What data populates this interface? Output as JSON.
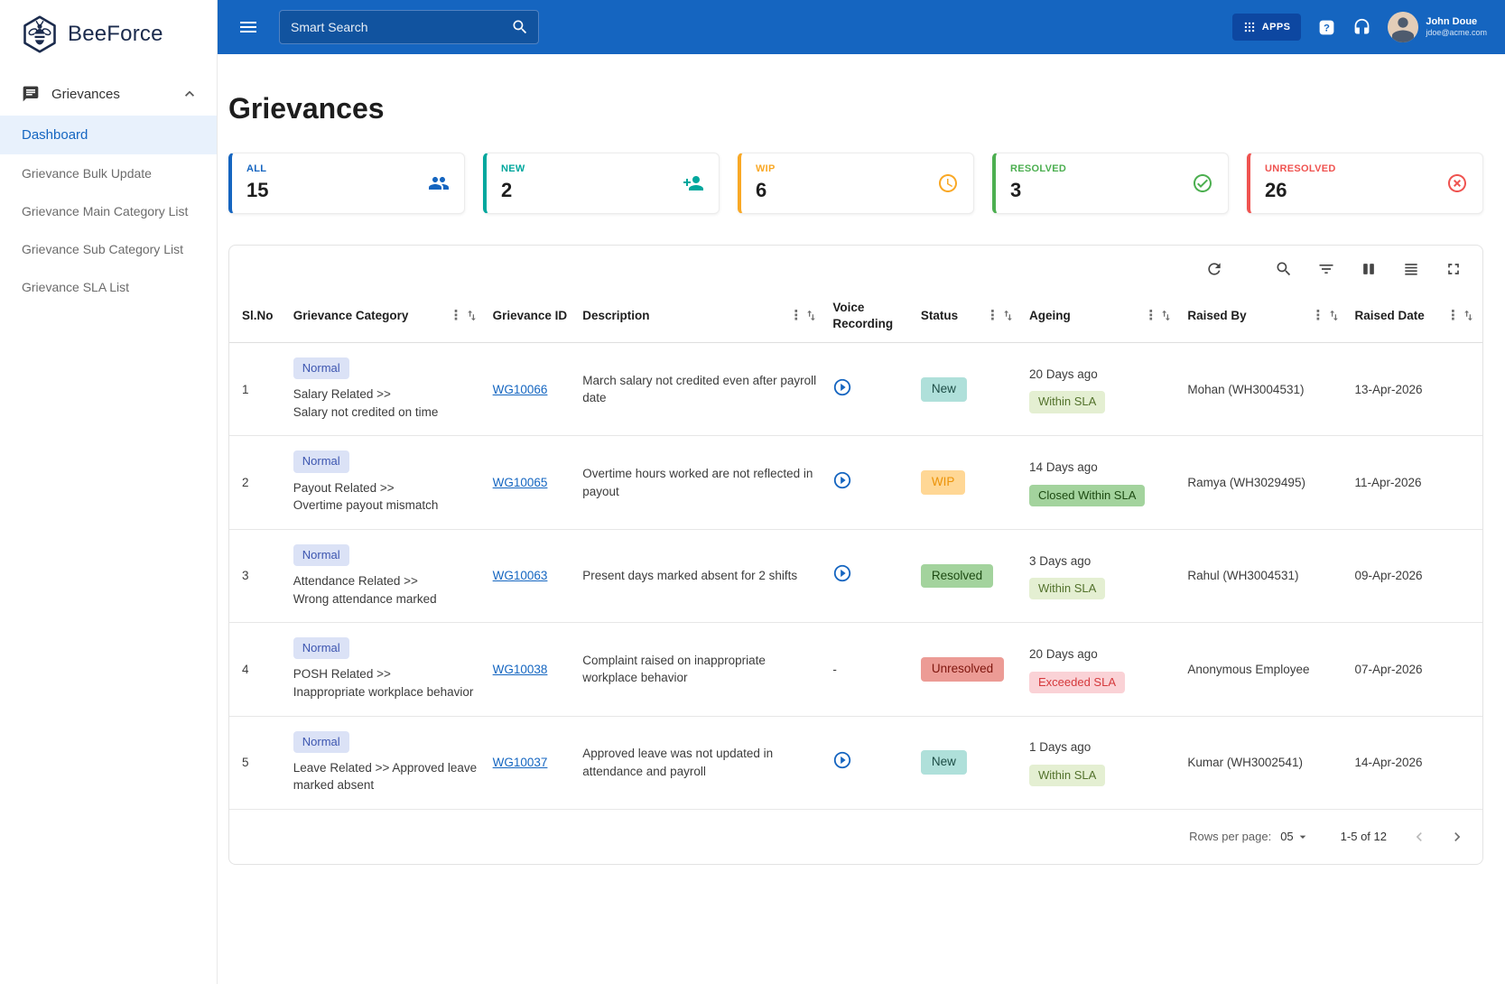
{
  "brand": {
    "name": "BeeForce"
  },
  "topbar": {
    "search_placeholder": "Smart Search",
    "apps_label": "APPS",
    "user": {
      "name": "John Doue",
      "email": "jdoe@acme.com"
    }
  },
  "sidebar": {
    "section_label": "Grievances",
    "items": [
      {
        "label": "Dashboard"
      },
      {
        "label": "Grievance Bulk Update"
      },
      {
        "label": "Grievance Main Category List"
      },
      {
        "label": "Grievance Sub Category List"
      },
      {
        "label": "Grievance SLA List"
      }
    ]
  },
  "page": {
    "title": "Grievances"
  },
  "stats": [
    {
      "label": "ALL",
      "value": "15",
      "icon": "people-icon",
      "color": "#1565c0"
    },
    {
      "label": "NEW",
      "value": "2",
      "icon": "person-add-icon",
      "color": "#00a79d"
    },
    {
      "label": "WIP",
      "value": "6",
      "icon": "clock-icon",
      "color": "#f9a825"
    },
    {
      "label": "RESOLVED",
      "value": "3",
      "icon": "check-circle-icon",
      "color": "#4caf50"
    },
    {
      "label": "UNRESOLVED",
      "value": "26",
      "icon": "cancel-circle-icon",
      "color": "#ef5350"
    }
  ],
  "table": {
    "columns": [
      {
        "label": "Sl.No"
      },
      {
        "label": "Grievance Category"
      },
      {
        "label": "Grievance ID"
      },
      {
        "label": "Description"
      },
      {
        "label": "Voice Recording"
      },
      {
        "label": "Status"
      },
      {
        "label": "Ageing"
      },
      {
        "label": "Raised By"
      },
      {
        "label": "Raised Date"
      }
    ],
    "rows": [
      {
        "slno": "1",
        "priority": "Normal",
        "category": "Salary Related >>\nSalary not credited on time",
        "id": "WG10066",
        "description": "March salary not credited even after payroll date",
        "voice": "play",
        "status": "New",
        "ageing": "20 Days ago",
        "sla": "Within SLA",
        "raised_by": "Mohan (WH3004531)",
        "raised_date": "13-Apr-2026"
      },
      {
        "slno": "2",
        "priority": "Normal",
        "category": "Payout Related >>\nOvertime payout mismatch",
        "id": "WG10065",
        "description": "Overtime hours worked are not reflected in payout",
        "voice": "play",
        "status": "WIP",
        "ageing": "14 Days ago",
        "sla": "Closed Within SLA",
        "raised_by": "Ramya (WH3029495)",
        "raised_date": "11-Apr-2026"
      },
      {
        "slno": "3",
        "priority": "Normal",
        "category": "Attendance Related >>\nWrong attendance marked",
        "id": "WG10063",
        "description": "Present days marked absent for 2 shifts",
        "voice": "play",
        "status": "Resolved",
        "ageing": "3 Days ago",
        "sla": "Within SLA",
        "raised_by": "Rahul (WH3004531)",
        "raised_date": "09-Apr-2026"
      },
      {
        "slno": "4",
        "priority": "Normal",
        "category": "POSH Related >>\nInappropriate workplace behavior",
        "id": "WG10038",
        "description": "Complaint raised on inappropriate workplace behavior",
        "voice": "-",
        "status": "Unresolved",
        "ageing": "20 Days ago",
        "sla": "Exceeded SLA",
        "raised_by": "Anonymous Employee",
        "raised_date": "07-Apr-2026"
      },
      {
        "slno": "5",
        "priority": "Normal",
        "category": "Leave Related >> Approved leave marked absent",
        "id": "WG10037",
        "description": "Approved leave was not updated in attendance and payroll",
        "voice": "play",
        "status": "New",
        "ageing": "1 Days ago",
        "sla": "Within SLA",
        "raised_by": "Kumar (WH3002541)",
        "raised_date": "14-Apr-2026"
      }
    ],
    "footer": {
      "rows_per_page_label": "Rows per page:",
      "rows_per_page": "05",
      "range": "1-5 of 12"
    }
  },
  "palette": {
    "topbar": "#1565c0",
    "active_nav_bg": "#e8f1fc",
    "badge_normal_bg": "#dbe2f6",
    "status_new_bg": "#afe0da",
    "status_wip_bg": "#ffd795",
    "status_resolved_bg": "#a3d39d",
    "status_unresolved_bg": "#ec9b95",
    "sla_within_bg": "#e4efd2",
    "sla_closed_bg": "#a3d39d",
    "sla_exceeded_bg": "#fad2d6"
  }
}
